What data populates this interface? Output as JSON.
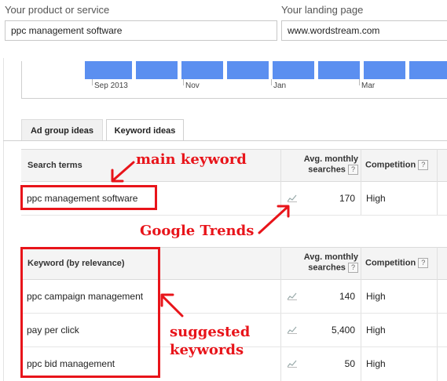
{
  "fields": {
    "product_label": "Your product or service",
    "product_value": "ppc management software",
    "landing_label": "Your landing page",
    "landing_value": "www.wordstream.com"
  },
  "chart_data": {
    "type": "bar",
    "x_tick_labels": [
      "Sep 2013",
      "Nov",
      "Jan",
      "Mar"
    ],
    "bar_color": "#5b8ff0"
  },
  "tabs": [
    {
      "label": "Ad group ideas",
      "active": false
    },
    {
      "label": "Keyword ideas",
      "active": true
    }
  ],
  "search_terms_table": {
    "headers": {
      "term": "Search terms",
      "searches": "Avg. monthly searches",
      "competition": "Competition"
    },
    "rows": [
      {
        "keyword": "ppc management software",
        "searches": "170",
        "competition": "High"
      }
    ]
  },
  "keyword_table": {
    "headers": {
      "term": "Keyword (by relevance)",
      "searches": "Avg. monthly searches",
      "competition": "Competition"
    },
    "rows": [
      {
        "keyword": "ppc campaign management",
        "searches": "140",
        "competition": "High"
      },
      {
        "keyword": "pay per click",
        "searches": "5,400",
        "competition": "High"
      },
      {
        "keyword": "ppc bid management",
        "searches": "50",
        "competition": "High"
      }
    ]
  },
  "annotations": {
    "main_keyword": "main keyword",
    "google_trends": "Google Trends",
    "suggested_1": "suggested",
    "suggested_2": "keywords"
  },
  "help_glyph": "?",
  "accent": "#e8141a"
}
